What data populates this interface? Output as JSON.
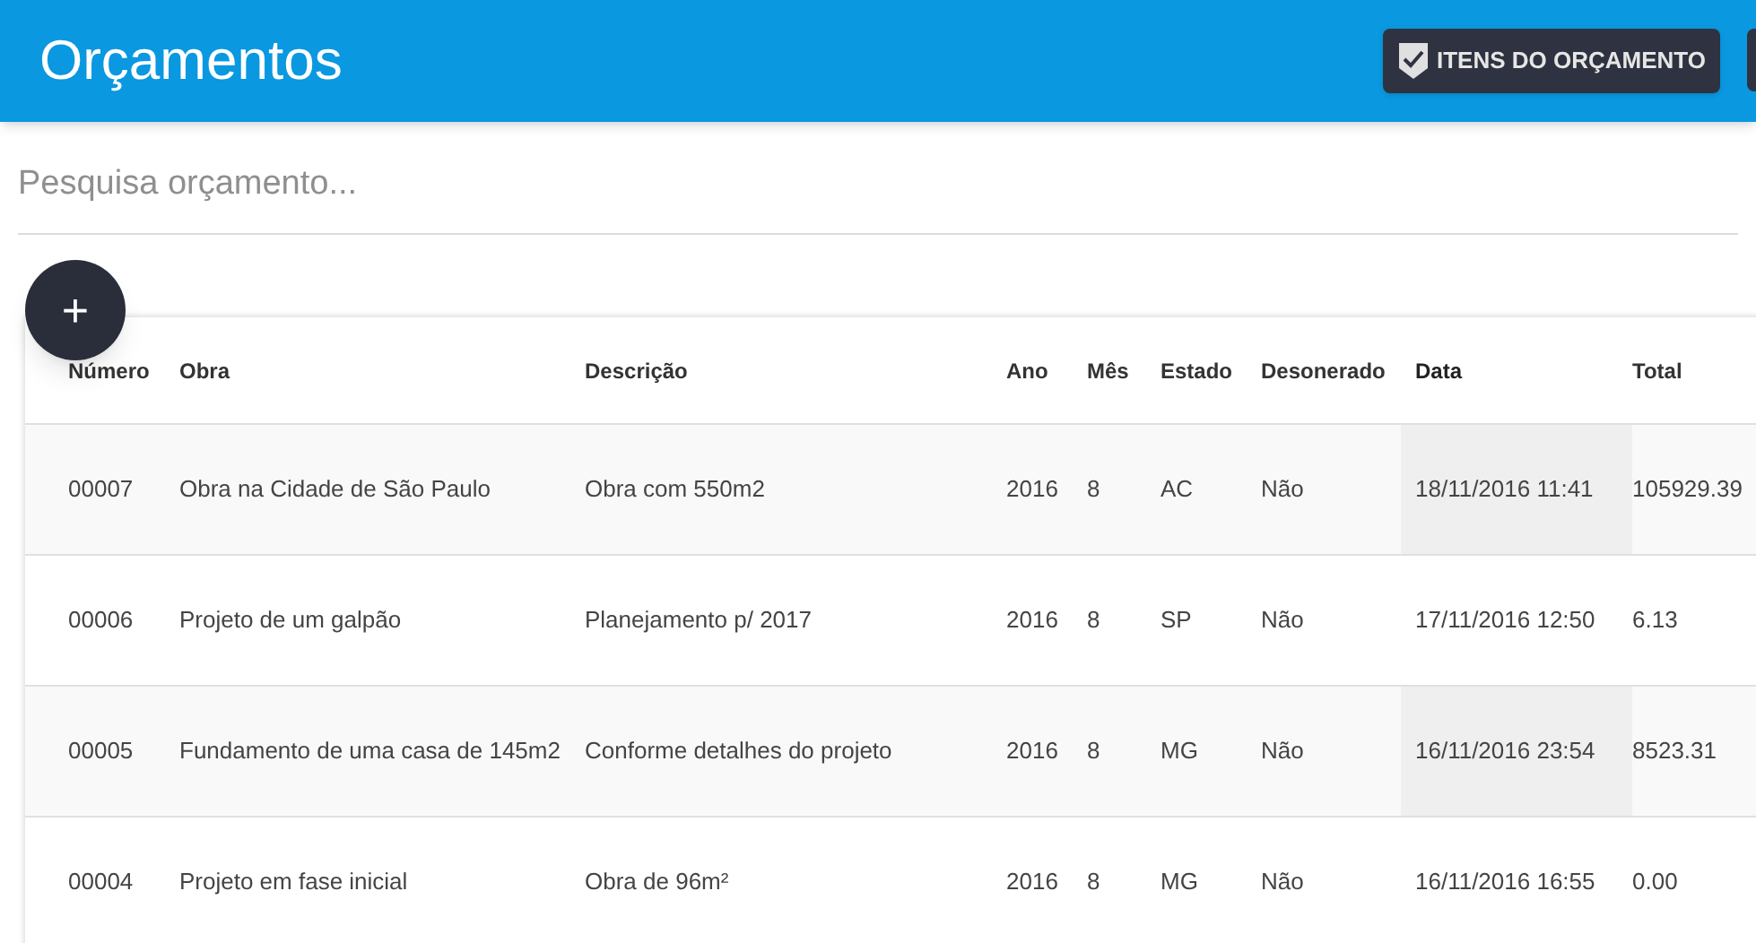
{
  "header": {
    "title": "Orçamentos",
    "buttons": [
      {
        "label": "ITENS DO ORÇAMENTO"
      }
    ]
  },
  "search": {
    "placeholder": "Pesquisa orçamento..."
  },
  "add_button": {
    "label": "+"
  },
  "table": {
    "columns": [
      {
        "label": "Número",
        "highlighted": false
      },
      {
        "label": "Obra",
        "highlighted": false
      },
      {
        "label": "Descrição",
        "highlighted": false
      },
      {
        "label": "Ano",
        "highlighted": false
      },
      {
        "label": "Mês",
        "highlighted": false
      },
      {
        "label": "Estado",
        "highlighted": false
      },
      {
        "label": "Desonerado",
        "highlighted": false
      },
      {
        "label": "Data",
        "highlighted": true
      },
      {
        "label": "Total",
        "highlighted": false
      }
    ],
    "rows": [
      [
        "00007",
        "Obra na Cidade de São Paulo",
        "Obra com 550m2",
        "2016",
        "8",
        "AC",
        "Não",
        "18/11/2016 11:41",
        "105929.39"
      ],
      [
        "00006",
        "Projeto de um galpão",
        "Planejamento p/ 2017",
        "2016",
        "8",
        "SP",
        "Não",
        "17/11/2016 12:50",
        "6.13"
      ],
      [
        "00005",
        "Fundamento de uma casa de 145m2",
        "Conforme detalhes do projeto",
        "2016",
        "8",
        "MG",
        "Não",
        "16/11/2016 23:54",
        "8523.31"
      ],
      [
        "00004",
        "Projeto em fase inicial",
        "Obra de 96m²",
        "2016",
        "8",
        "MG",
        "Não",
        "16/11/2016 16:55",
        "0.00"
      ]
    ]
  }
}
